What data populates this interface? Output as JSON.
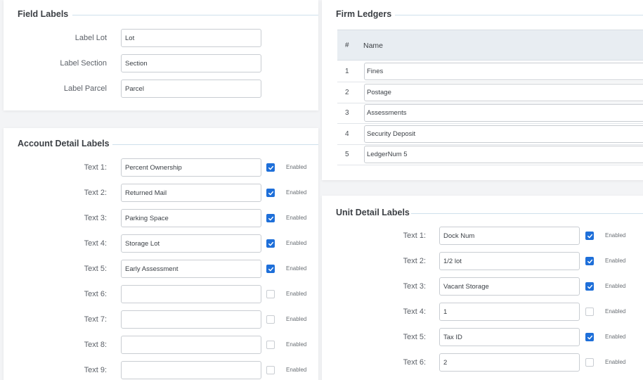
{
  "field_labels": {
    "title": "Field Labels",
    "rows": [
      {
        "label": "Label Lot",
        "value": "Lot"
      },
      {
        "label": "Label Section",
        "value": "Section"
      },
      {
        "label": "Label Parcel",
        "value": "Parcel"
      }
    ]
  },
  "account_detail": {
    "title": "Account Detail Labels",
    "enabled_label": "Enabled",
    "rows": [
      {
        "label": "Text 1:",
        "value": "Percent Ownership",
        "enabled": true
      },
      {
        "label": "Text 2:",
        "value": "Returned Mail",
        "enabled": true
      },
      {
        "label": "Text 3:",
        "value": "Parking Space",
        "enabled": true
      },
      {
        "label": "Text 4:",
        "value": "Storage Lot",
        "enabled": true
      },
      {
        "label": "Text 5:",
        "value": "Early Assessment",
        "enabled": true
      },
      {
        "label": "Text 6:",
        "value": "",
        "enabled": false
      },
      {
        "label": "Text 7:",
        "value": "",
        "enabled": false
      },
      {
        "label": "Text 8:",
        "value": "",
        "enabled": false
      },
      {
        "label": "Text 9:",
        "value": "",
        "enabled": false
      }
    ]
  },
  "firm_ledgers": {
    "title": "Firm Ledgers",
    "columns": [
      "#",
      "Name"
    ],
    "rows": [
      {
        "num": "1",
        "name": "Fines"
      },
      {
        "num": "2",
        "name": "Postage"
      },
      {
        "num": "3",
        "name": "Assessments"
      },
      {
        "num": "4",
        "name": "Security Deposit"
      },
      {
        "num": "5",
        "name": "LedgerNum 5"
      }
    ]
  },
  "unit_detail": {
    "title": "Unit Detail Labels",
    "enabled_label": "Enabled",
    "rows": [
      {
        "label": "Text 1:",
        "value": "Dock Num",
        "enabled": true
      },
      {
        "label": "Text 2:",
        "value": "1/2 lot",
        "enabled": true
      },
      {
        "label": "Text 3:",
        "value": "Vacant Storage",
        "enabled": true
      },
      {
        "label": "Text 4:",
        "value": "1",
        "enabled": false
      },
      {
        "label": "Text 5:",
        "value": "Tax ID",
        "enabled": true
      },
      {
        "label": "Text 6:",
        "value": "2",
        "enabled": false
      }
    ]
  },
  "colors": {
    "accent": "#1e6fd9",
    "rule": "#cfe0ec",
    "table_header": "#e8edf2"
  },
  "icons": {
    "checked": "check-icon"
  }
}
